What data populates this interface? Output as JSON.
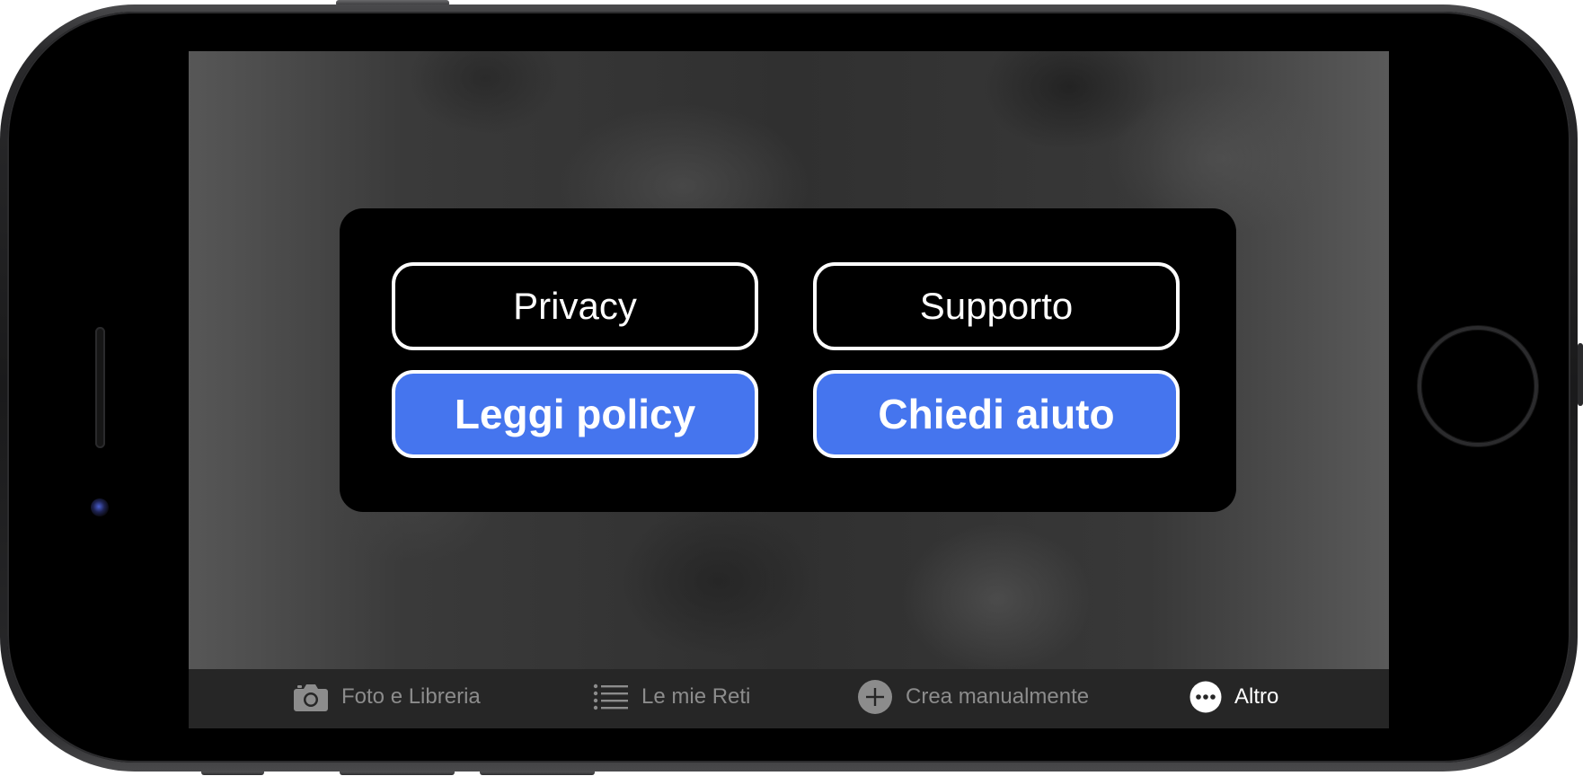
{
  "dialog": {
    "privacy_label": "Privacy",
    "support_label": "Supporto",
    "read_policy_label": "Leggi policy",
    "ask_help_label": "Chiedi aiuto",
    "accent_color": "#4575ee"
  },
  "tabbar": {
    "tabs": [
      {
        "label": "Foto e Libreria",
        "icon": "camera-icon",
        "active": false
      },
      {
        "label": "Le mie Reti",
        "icon": "list-icon",
        "active": false
      },
      {
        "label": "Crea manualmente",
        "icon": "plus-circle-icon",
        "active": false
      },
      {
        "label": "Altro",
        "icon": "more-icon",
        "active": true
      }
    ]
  },
  "colors": {
    "tab_inactive": "#8c8c8c",
    "tab_active": "#ffffff",
    "tabbar_bg": "#262626"
  }
}
